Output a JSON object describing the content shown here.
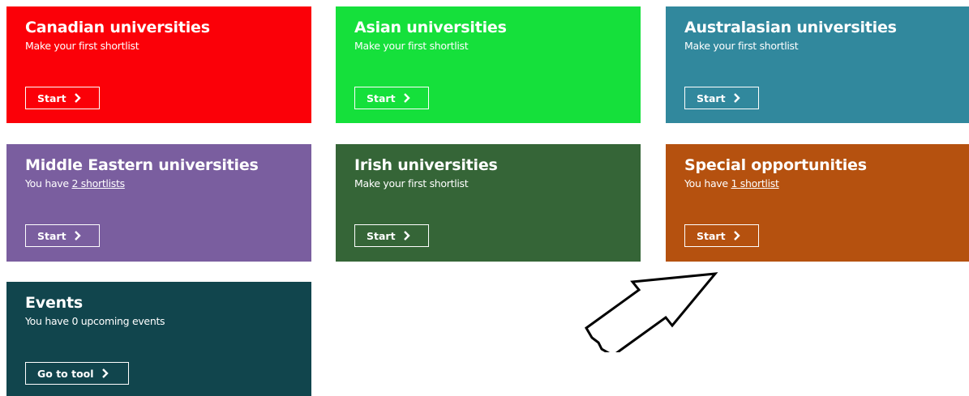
{
  "tiles": [
    {
      "title": "Canadian universities",
      "sub": "Make your first shortlist",
      "button": "Start",
      "color": "#fb0008"
    },
    {
      "title": "Asian universities",
      "sub": "Make your first shortlist",
      "button": "Start",
      "color": "#15e03b"
    },
    {
      "title": "Australasian universities",
      "sub": "Make your first shortlist",
      "button": "Start",
      "color": "#31889d"
    },
    {
      "title": "Middle Eastern universities",
      "sub_prefix": "You have ",
      "sub_link": "2 shortlists",
      "button": "Start",
      "color": "#7a5e9f"
    },
    {
      "title": "Irish universities",
      "sub": "Make your first shortlist",
      "button": "Start",
      "color": "#356537"
    },
    {
      "title": "Special opportunities",
      "sub_prefix": "You have ",
      "sub_link": "1 shortlist",
      "button": "Start",
      "color": "#b5510f"
    },
    {
      "title": "Events",
      "sub": "You have 0 upcoming events",
      "button": "Go to tool",
      "color": "#11454d"
    }
  ],
  "pointer": {
    "icon": "outline-arrow-icon"
  }
}
